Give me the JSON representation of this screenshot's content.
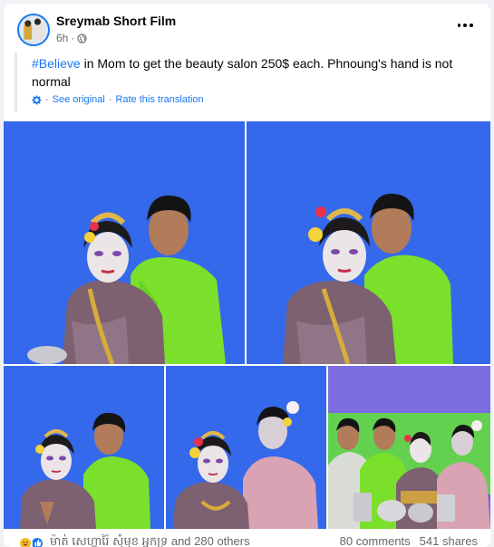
{
  "post": {
    "author": "Sreymab Short Film",
    "time": "6h",
    "privacy_icon": "globe-icon",
    "more_icon": "more-horizontal-icon",
    "hashtag": "#Believe",
    "text": " in Mom to get the beauty salon 250$ each. Phnoung's hand is not normal",
    "see_original": "See original",
    "separator": "·",
    "rate_translation": "Rate this translation"
  },
  "photos": [
    {
      "name": "photo-couple-1",
      "alt": "Couple in traditional Khmer costume on blue backdrop"
    },
    {
      "name": "photo-couple-2",
      "alt": "Couple in traditional Khmer costume on blue backdrop"
    },
    {
      "name": "photo-couple-3",
      "alt": "Couple posing with hands pressed together"
    },
    {
      "name": "photo-couple-4",
      "alt": "Two people in traditional costume with flowers"
    },
    {
      "name": "photo-group",
      "alt": "Group seated around silver offering bowls"
    }
  ],
  "footer": {
    "reaction_icons": [
      "haha-icon",
      "like-icon"
    ],
    "reactors": "ម៉ាត់ សេហ្គារ៉ៃ សុំមុខ អ្នកទ្រ and 280 others",
    "comments": "80 comments",
    "shares": "541 shares"
  },
  "colors": {
    "accent": "#1877f2",
    "secondary_text": "#65676b",
    "backdrop_blue": "#3a6ff2",
    "shirt_green": "#7be02c"
  }
}
